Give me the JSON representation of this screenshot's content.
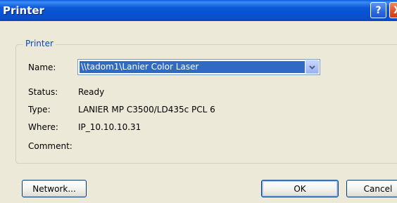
{
  "window": {
    "title": "Printer",
    "help_label": "?",
    "close_label": "X"
  },
  "group": {
    "legend": "Printer"
  },
  "fields": {
    "name_label": "Name:",
    "name_value": "\\\\tadom1\\Lanier Color Laser",
    "status_label": "Status:",
    "status_value": "Ready",
    "type_label": "Type:",
    "type_value": "LANIER MP C3500/LD435c PCL 6",
    "where_label": "Where:",
    "where_value": "IP_10.10.10.31",
    "comment_label": "Comment:",
    "comment_value": ""
  },
  "buttons": {
    "network": "Network...",
    "ok": "OK",
    "cancel": "Cancel"
  },
  "colors": {
    "titlebar": "#0a52d4",
    "legend_text": "#0046d5",
    "selection": "#316ac5",
    "dialog_bg": "#ece9d8"
  }
}
